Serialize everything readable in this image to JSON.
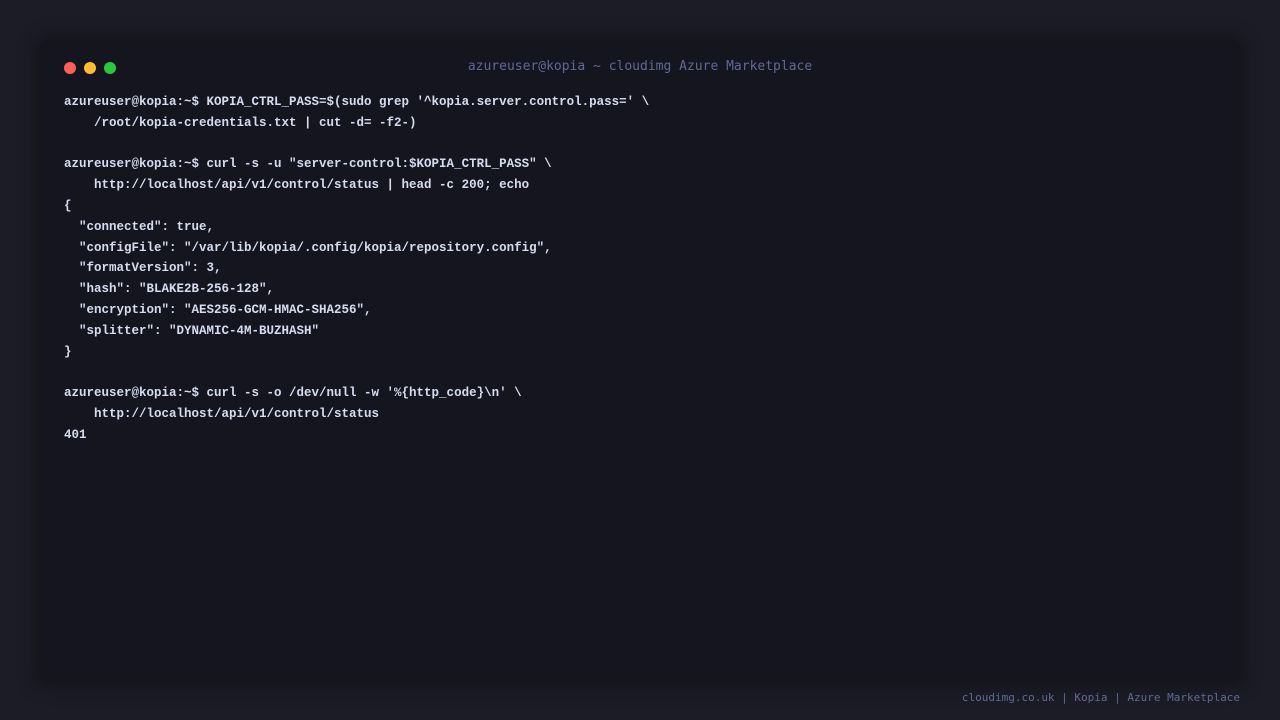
{
  "window": {
    "title": "azureuser@kopia ~ cloudimg Azure Marketplace",
    "controls": [
      {
        "name": "close",
        "color": "#ff5f57"
      },
      {
        "name": "minimize",
        "color": "#febc2e"
      },
      {
        "name": "maximize",
        "color": "#28c840"
      }
    ]
  },
  "terminal": {
    "lines": [
      "azureuser@kopia:~$ KOPIA_CTRL_PASS=$(sudo grep '^kopia.server.control.pass=' \\",
      "    /root/kopia-credentials.txt | cut -d= -f2-)",
      "",
      "azureuser@kopia:~$ curl -s -u \"server-control:$KOPIA_CTRL_PASS\" \\",
      "    http://localhost/api/v1/control/status | head -c 200; echo",
      "{",
      "  \"connected\": true,",
      "  \"configFile\": \"/var/lib/kopia/.config/kopia/repository.config\",",
      "  \"formatVersion\": 3,",
      "  \"hash\": \"BLAKE2B-256-128\",",
      "  \"encryption\": \"AES256-GCM-HMAC-SHA256\",",
      "  \"splitter\": \"DYNAMIC-4M-BUZHASH\"",
      "}",
      "",
      "azureuser@kopia:~$ curl -s -o /dev/null -w '%{http_code}\\n' \\",
      "    http://localhost/api/v1/control/status",
      "401"
    ]
  },
  "footer": {
    "text": "cloudimg.co.uk | Kopia | Azure Marketplace"
  }
}
